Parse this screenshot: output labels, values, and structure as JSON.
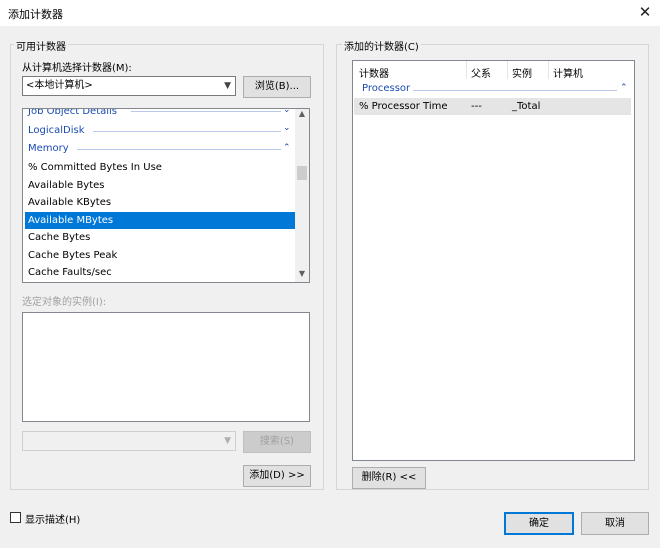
{
  "dialog": {
    "title": "添加计数器",
    "close_glyph": "✕"
  },
  "available": {
    "group_label": "可用计数器",
    "select_label": "从计算机选择计数器(M):",
    "computer_value": "<本地计算机>",
    "browse_label": "浏览(B)...",
    "categories": [
      {
        "label": "Job Object Details",
        "chevron": "⌄"
      },
      {
        "label": "LogicalDisk",
        "chevron": "⌄"
      },
      {
        "label": "Memory",
        "chevron": "⌃"
      }
    ],
    "counters": [
      "% Committed Bytes In Use",
      "Available Bytes",
      "Available KBytes",
      "Available MBytes",
      "Cache Bytes",
      "Cache Bytes Peak",
      "Cache Faults/sec"
    ],
    "selected_counter": "Available MBytes",
    "instances_label": "选定对象的实例(I):",
    "search_value": "",
    "search_label": "搜索(S)",
    "add_label": "添加(D) >>"
  },
  "added": {
    "group_label": "添加的计数器(C)",
    "columns": [
      "计数器",
      "父系",
      "实例",
      "计算机"
    ],
    "category": "Processor",
    "category_chevron": "⌃",
    "rows": [
      {
        "counter": "% Processor Time",
        "parent": "---",
        "instance": "_Total",
        "computer": ""
      }
    ],
    "remove_label": "删除(R) <<"
  },
  "footer": {
    "show_description_label": "显示描述(H)",
    "ok_label": "确定",
    "cancel_label": "取消"
  }
}
